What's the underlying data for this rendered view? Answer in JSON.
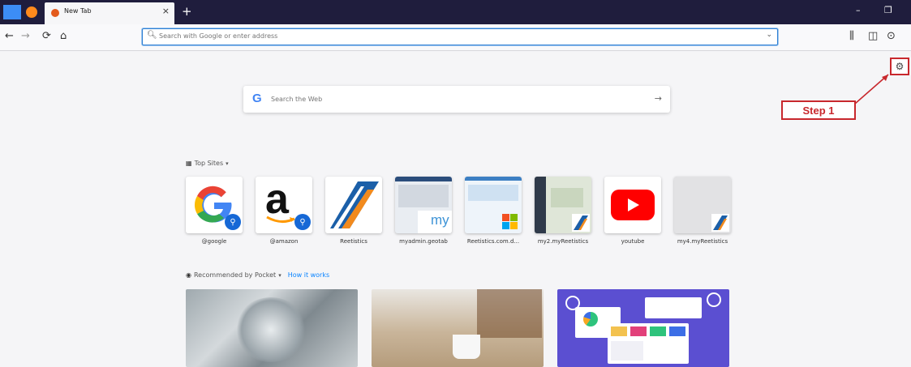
{
  "tabbar": {
    "tab_title": "New Tab",
    "close_symbol": "×",
    "new_tab_symbol": "+",
    "minimize_symbol": "–",
    "restore_symbol": "❐"
  },
  "navbar": {
    "back_symbol": "←",
    "forward_symbol": "→",
    "reload_symbol": "⟳",
    "home_symbol": "⌂",
    "url_placeholder": "Search with Google or enter address",
    "dropdown_symbol": "⌄",
    "library_symbol": "⫼",
    "sidebar_symbol": "◫",
    "account_symbol": "⊙"
  },
  "annotation": {
    "step_label": "Step 1",
    "color": "#c8282d"
  },
  "web_search": {
    "placeholder": "Search the Web",
    "go_symbol": "→"
  },
  "top_sites": {
    "heading": "Top Sites",
    "items": [
      {
        "label": "@google",
        "icon": "google-search-icon"
      },
      {
        "label": "@amazon",
        "icon": "amazon-search-icon"
      },
      {
        "label": "Reetistics",
        "icon": "reetistics-logo-icon"
      },
      {
        "label": "myadmin.geotab",
        "icon": "geotab-thumbnail"
      },
      {
        "label": "Reetistics.com.d...",
        "icon": "reetistics-site-thumbnail"
      },
      {
        "label": "my2.myReetistics",
        "icon": "map-thumbnail"
      },
      {
        "label": "youtube",
        "icon": "youtube-logo-icon"
      },
      {
        "label": "my4.myReetistics",
        "icon": "reetistics-small-icon"
      }
    ]
  },
  "pocket": {
    "heading": "Recommended by Pocket",
    "link": "How it works"
  },
  "colors": {
    "tabbar_bg": "#1f1d3d",
    "accent": "#0a84ff",
    "annotation": "#c8282d"
  }
}
